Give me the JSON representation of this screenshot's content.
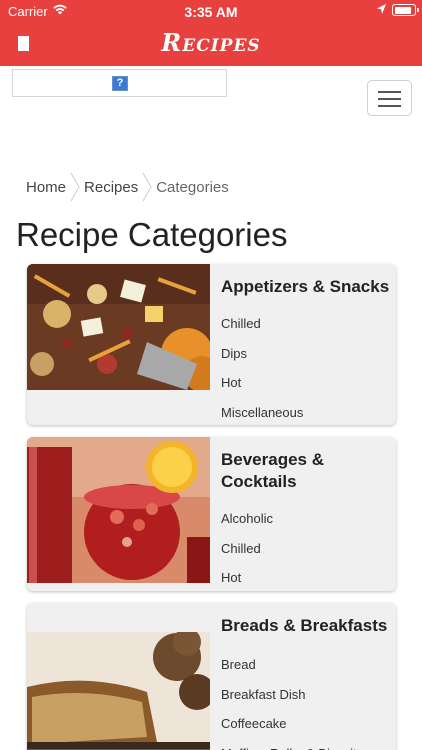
{
  "status": {
    "carrier": "Carrier",
    "time": "3:35 AM",
    "battery_level": 0.9
  },
  "nav": {
    "title": "Recipes"
  },
  "breadcrumb": [
    "Home",
    "Recipes",
    "Categories"
  ],
  "page_title": "Recipe Categories",
  "ad": {
    "icon": "?"
  },
  "categories": [
    {
      "title": "Appetizers & Snacks",
      "items": [
        "Chilled",
        "Dips",
        "Hot",
        "Miscellaneous"
      ]
    },
    {
      "title": "Beverages & Cocktails",
      "items": [
        "Alcoholic",
        "Chilled",
        "Hot"
      ]
    },
    {
      "title": "Breads & Breakfasts",
      "items": [
        "Bread",
        "Breakfast Dish",
        "Coffeecake",
        "Muffins, Rolls, & Biscuits"
      ]
    }
  ],
  "colors": {
    "nav_bg": "#e8403f",
    "card_bg": "#f0f0f0"
  }
}
